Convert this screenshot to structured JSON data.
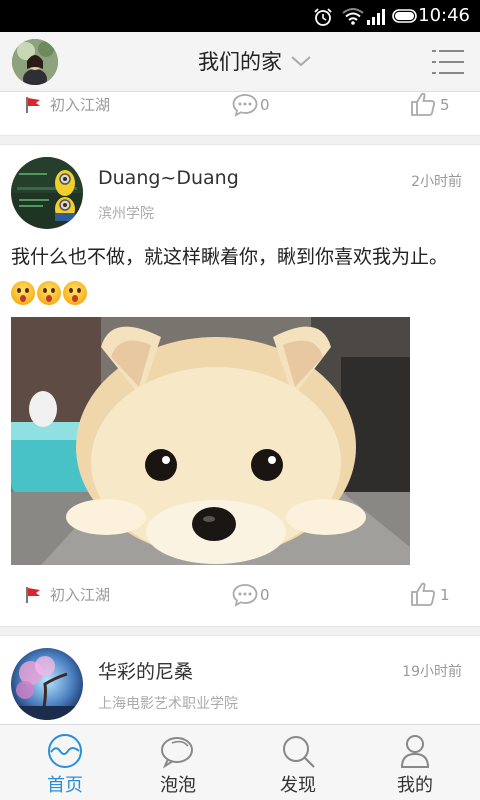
{
  "status_bar": {
    "time": "10:46",
    "icons": [
      "alarm-icon",
      "wifi-icon",
      "signal-icon",
      "battery-icon"
    ]
  },
  "header": {
    "title": "我们的家",
    "left_icon": "user-avatar",
    "dropdown_icon": "chevron-down-icon",
    "menu_icon": "list-menu-icon"
  },
  "top_partial_post": {
    "tag": "初入江湖",
    "comments": "0",
    "likes": "5"
  },
  "posts": [
    {
      "name": "Duang~Duang",
      "time": "2小时前",
      "school": "滨州学院",
      "text": "我什么也不做，就这样瞅着你，瞅到你喜欢我为止。",
      "emoji_count": 3,
      "tag": "初入江湖",
      "comments": "0",
      "likes": "1"
    },
    {
      "name": "华彩的尼桑",
      "time": "19小时前",
      "school": "上海电影艺术职业学院"
    }
  ],
  "bottom_nav": [
    {
      "label": "首页",
      "icon": "home-wave-icon",
      "active": true
    },
    {
      "label": "泡泡",
      "icon": "chat-bubble-icon",
      "active": false
    },
    {
      "label": "发现",
      "icon": "search-icon",
      "active": false
    },
    {
      "label": "我的",
      "icon": "person-icon",
      "active": false
    }
  ],
  "colors": {
    "accent": "#2a8fd6",
    "flag": "#d9262b",
    "meta_text": "#999999"
  }
}
